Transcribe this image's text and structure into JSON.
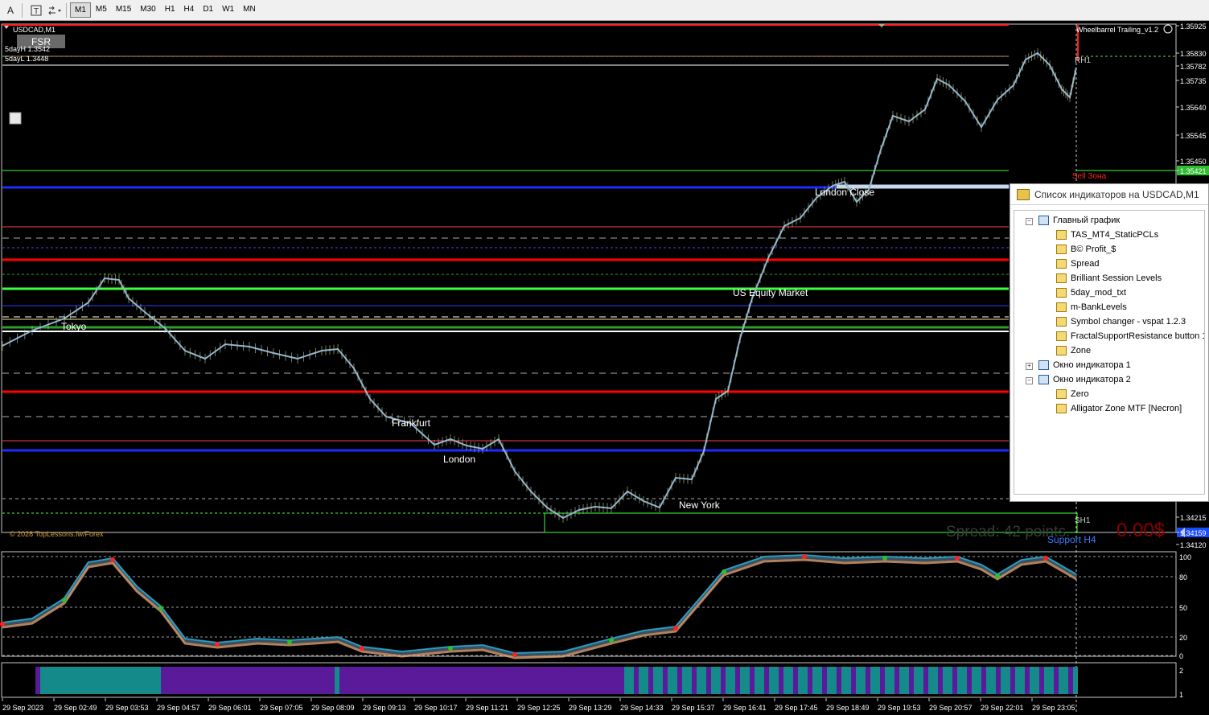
{
  "toolbar": {
    "icons": [
      "text-A-icon",
      "text-label-icon",
      "arrows-icon"
    ],
    "timeframes": [
      "M1",
      "M5",
      "M15",
      "M30",
      "H1",
      "H4",
      "D1",
      "W1",
      "MN"
    ],
    "active_timeframe": "M1"
  },
  "chart": {
    "symbol_label": "USDCAD,M1",
    "fsr_label": "FSR",
    "day_high_label": "5dayH 1.3542",
    "day_low_label": "5dayL 1.3448",
    "ea_label": "Wheelbarrel Trailing_v1.2",
    "copyright": "© 2028 TopLessons.fw/Forex",
    "spread_text": "Spread: 42 points.",
    "profit_text": "0.00$",
    "sell_zone": "Sell Зона",
    "support_h4": "Support H4",
    "rh1": "RH1",
    "sh1": "SH1",
    "sessions": [
      "Tokyo",
      "Frankfurt",
      "London",
      "New York",
      "US Equity Market",
      "London Close"
    ],
    "price_ticks": [
      "1.35925",
      "1.35830",
      "1.35782",
      "1.35735",
      "1.35640",
      "1.35545",
      "1.35450",
      "1.35421",
      "1.34215",
      "1.34159",
      "1.34120"
    ],
    "indicator_ticks": [
      "100",
      "80",
      "50",
      "20",
      "0"
    ],
    "lower_ticks": [
      "2",
      "1"
    ],
    "time_labels": [
      "29 Sep 2023",
      "29 Sep 02:49",
      "29 Sep 03:53",
      "29 Sep 04:57",
      "29 Sep 06:01",
      "29 Sep 07:05",
      "29 Sep 08:09",
      "29 Sep 09:13",
      "29 Sep 10:17",
      "29 Sep 11:21",
      "29 Sep 12:25",
      "29 Sep 13:29",
      "29 Sep 14:33",
      "29 Sep 15:37",
      "29 Sep 16:41",
      "29 Sep 17:45",
      "29 Sep 18:49",
      "29 Sep 19:53",
      "29 Sep 20:57",
      "29 Sep 22:01",
      "29 Sep 23:05"
    ],
    "colors": {
      "candle": "#8ab4d8",
      "red_level": "#ff0000",
      "green_level": "#3cff3c",
      "blue_level": "#1a2cff",
      "current_price_bg": "#2ebd2e",
      "support_price_bg": "#1a4cff"
    }
  },
  "panel": {
    "title": "Список индикаторов на USDCAD,M1",
    "groups": [
      {
        "label": "Главный график",
        "items": [
          "TAS_MT4_StaticPCLs",
          "B© Profit_$",
          "Spread",
          "Brilliant Session Levels",
          "5day_mod_txt",
          "m-BankLevels",
          "Symbol changer - vspat 1.2.3",
          "FractalSupportResistance button 1.",
          "Zone"
        ]
      },
      {
        "label": "Окно индикатора 1",
        "items": []
      },
      {
        "label": "Окно индикатора 2",
        "items": [
          "Zero",
          "Alligator Zone MTF [Necron]"
        ]
      }
    ]
  }
}
